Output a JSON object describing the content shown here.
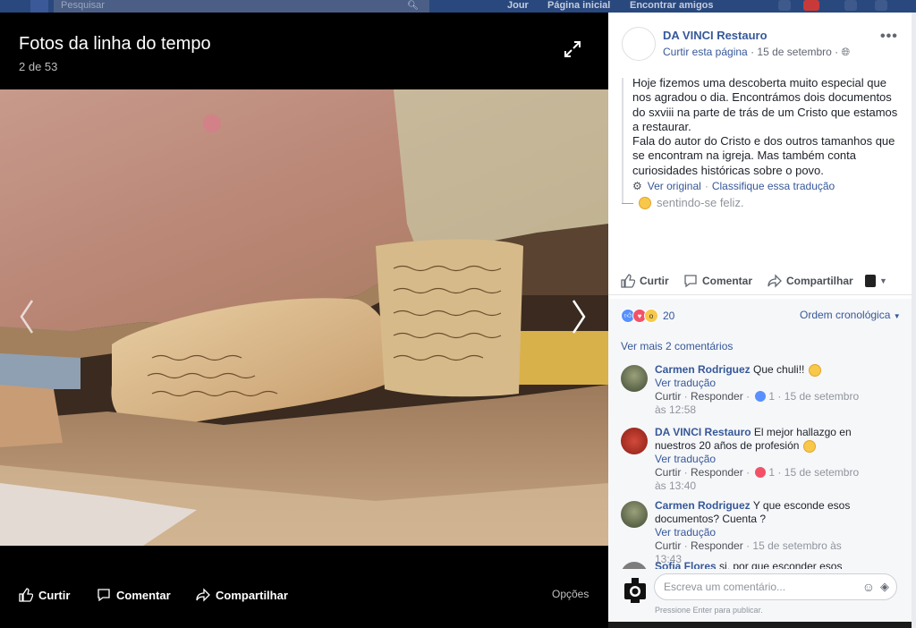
{
  "topbar": {
    "search_placeholder": "Pesquisar",
    "nav": [
      "Jour",
      "Página inicial",
      "Encontrar amigos"
    ]
  },
  "viewer": {
    "title": "Fotos da linha do tempo",
    "count": "2 de 53",
    "actions": {
      "like": "Curtir",
      "comment": "Comentar",
      "share": "Compartilhar"
    },
    "options": "Opções"
  },
  "post": {
    "page_name": "DA VINCI Restauro",
    "like_page": "Curtir esta página",
    "date": "15 de setembro",
    "text": [
      "Hoje fizemos uma descoberta muito especial que nos agradou o dia. Encontrámos dois documentos do sxviii na parte de trás de um Cristo que estamos a restaurar.",
      "Fala do autor do Cristo e dos outros tamanhos que se encontram na igreja. Mas também conta curiosidades históricas sobre o povo."
    ],
    "see_original": "Ver original",
    "rate_translation": "Classifique essa tradução",
    "feeling": "sentindo-se feliz.",
    "actions": {
      "like": "Curtir",
      "comment": "Comentar",
      "share": "Compartilhar"
    }
  },
  "reactions": {
    "count": "20",
    "order": "Ordem cronológica"
  },
  "more_comments": "Ver mais 2 comentários",
  "comments": [
    {
      "author": "Carmen Rodriguez",
      "text": "Que chuli!!",
      "translate": "Ver tradução",
      "like": "Curtir",
      "reply": "Responder",
      "reacts": "1",
      "date": "15 de setembro às 12:58"
    },
    {
      "author": "DA VINCI Restauro",
      "text": "El mejor hallazgo en nuestros 20 años de profesión",
      "translate": "Ver tradução",
      "like": "Curtir",
      "reply": "Responder",
      "reacts": "1",
      "date": "15 de setembro às 13:40"
    },
    {
      "author": "Carmen Rodriguez",
      "text": "Y que esconde esos documentos? Cuenta ?",
      "translate": "Ver tradução",
      "like": "Curtir",
      "reply": "Responder",
      "date": "15 de setembro às 13:43"
    },
    {
      "author": "Sofia Flores",
      "text": "si, por que esconder esos"
    }
  ],
  "composer": {
    "placeholder": "Escreva um comentário...",
    "hint": "Pressione Enter para publicar."
  }
}
